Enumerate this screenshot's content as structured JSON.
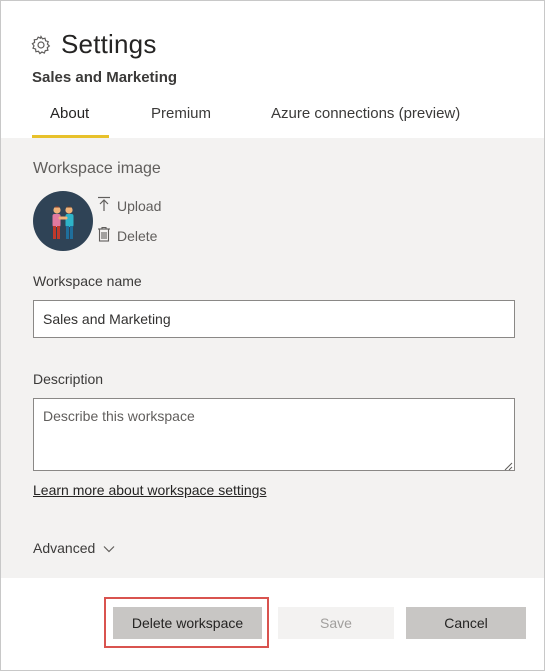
{
  "header": {
    "title": "Settings",
    "workspace": "Sales and Marketing",
    "icon": "gear-icon"
  },
  "tabs": [
    {
      "label": "About",
      "active": true
    },
    {
      "label": "Premium",
      "active": false
    },
    {
      "label": "Azure connections (preview)",
      "active": false
    }
  ],
  "about": {
    "image_section_title": "Workspace image",
    "upload_label": "Upload",
    "delete_image_label": "Delete",
    "name_label": "Workspace name",
    "name_value": "Sales and Marketing",
    "description_label": "Description",
    "description_placeholder": "Describe this workspace",
    "learn_more_link": "Learn more about workspace settings",
    "advanced_label": "Advanced"
  },
  "footer": {
    "delete_workspace": "Delete workspace",
    "save": "Save",
    "cancel": "Cancel"
  },
  "colors": {
    "accent_underline": "#e8c12b",
    "highlight_border": "#d9534f",
    "body_background": "#f3f2f1"
  }
}
